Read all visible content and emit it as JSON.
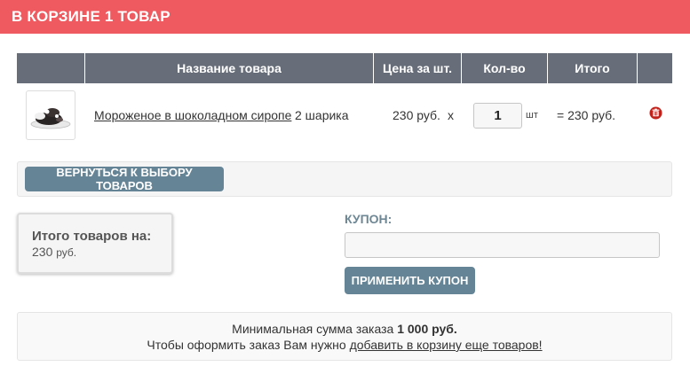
{
  "header": {
    "title": "В КОРЗИНЕ 1 ТОВАР",
    "bg_color": "#ee5a5f"
  },
  "table": {
    "columns": [
      "Название товара",
      "Цена за шт.",
      "Кол-во",
      "Итого"
    ],
    "header_color": "#676e79",
    "rows": [
      {
        "image_icon": "ice-cream-dessert-image",
        "name": "Мороженое в шоколадном сиропе",
        "variant": "2 шарика",
        "price": "230 руб.",
        "times": "x",
        "quantity": "1",
        "unit": "шт",
        "total": "= 230 руб.",
        "delete_icon": "trash-icon"
      }
    ]
  },
  "back_button": {
    "label": "ВЕРНУТЬСЯ К ВЫБОРУ ТОВАРОВ"
  },
  "summary": {
    "label": "Итого товаров на:",
    "amount": "230",
    "currency": "руб."
  },
  "coupon": {
    "label": "КУПОН:",
    "value": "",
    "button_label": "ПРИМЕНИТЬ КУПОН",
    "accent_color": "#658597"
  },
  "notice": {
    "line1_prefix": "Минимальная сумма заказа ",
    "line1_amount": "1 000 руб.",
    "line2_prefix": "Чтобы оформить заказ Вам нужно ",
    "line2_link": "добавить в корзину еще товаров!"
  }
}
